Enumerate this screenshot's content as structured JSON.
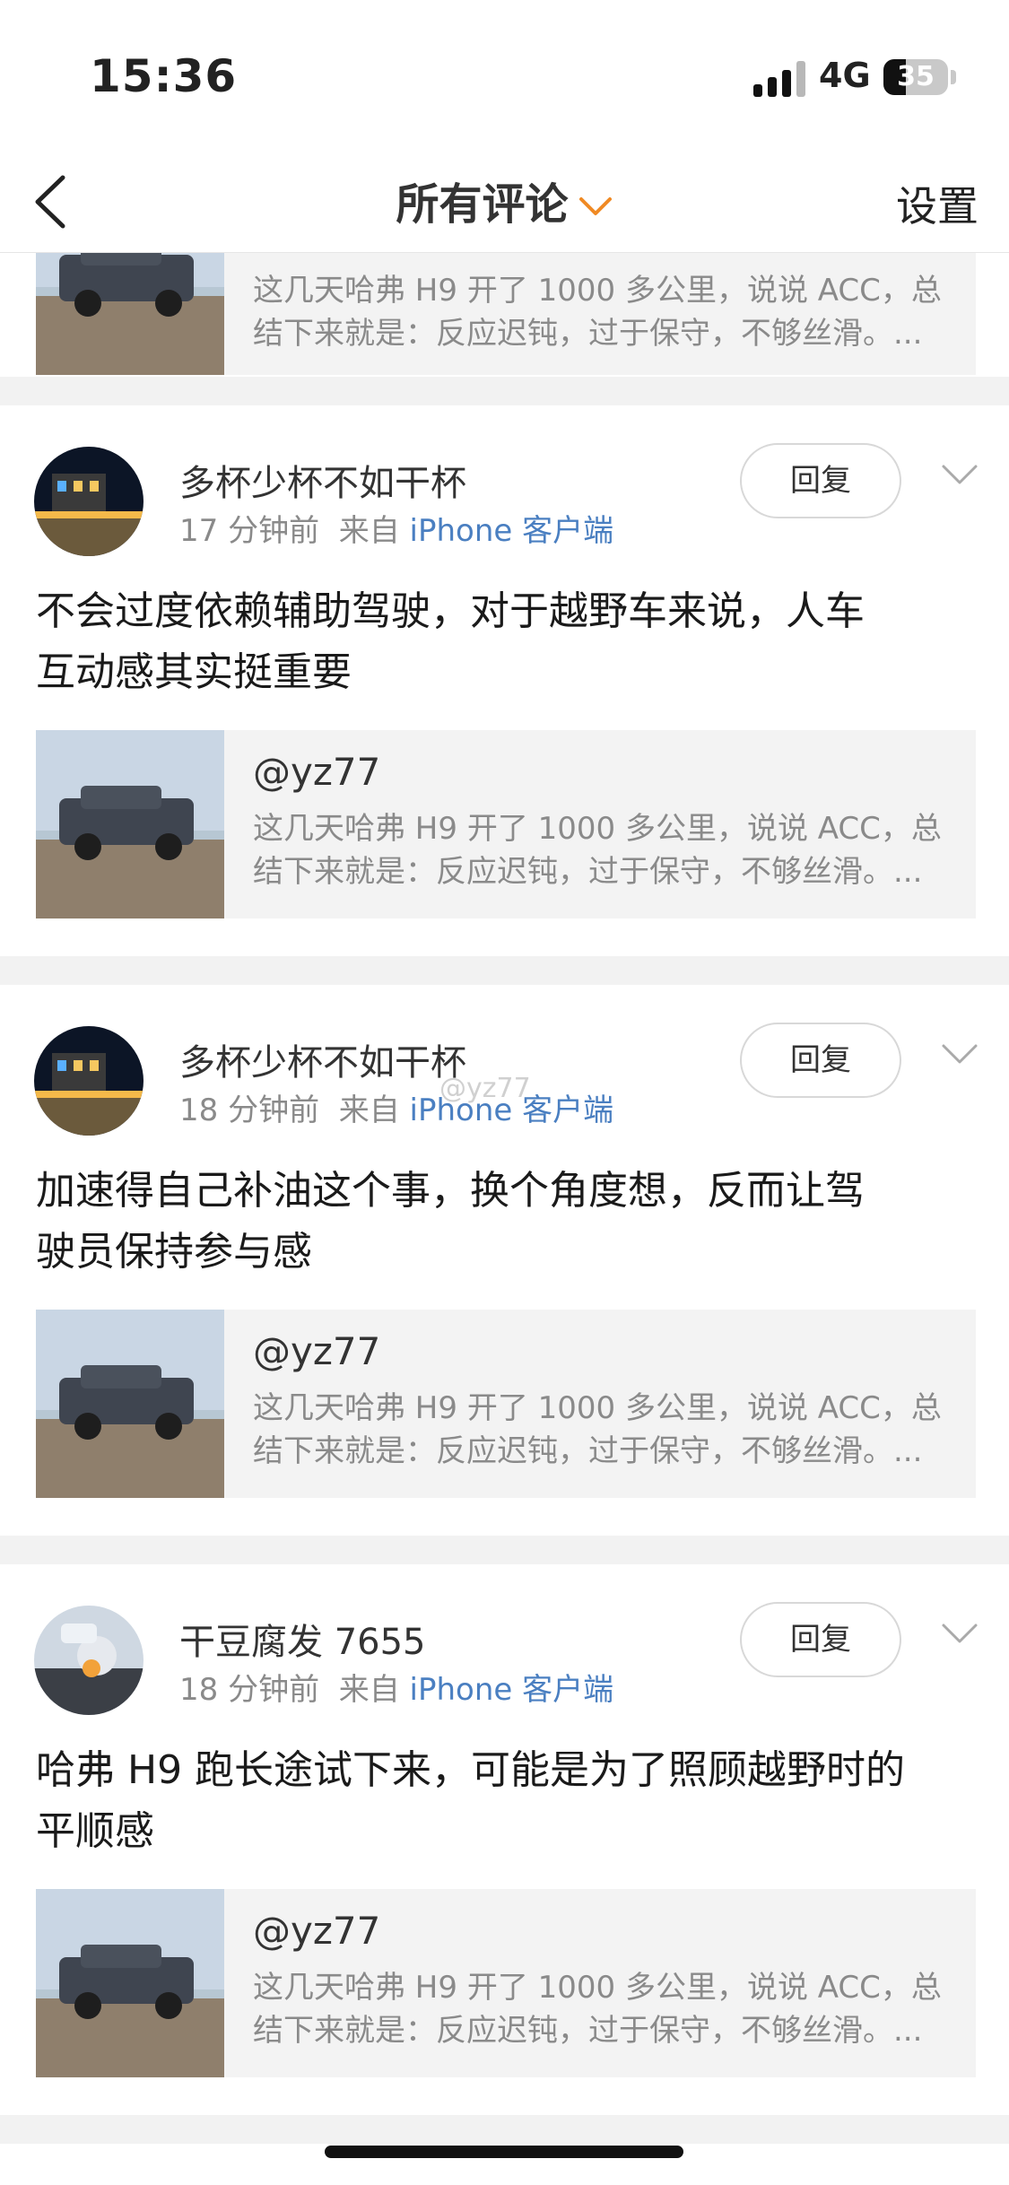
{
  "status": {
    "time": "15:36",
    "network": "4G",
    "battery": "35",
    "battery_level": 0.35
  },
  "nav": {
    "title": "所有评论",
    "settings": "设置"
  },
  "quoted_post": {
    "user": "@yz77",
    "line1": "这几天哈弗 H9 开了 1000 多公里，说说 ACC，总",
    "line2": "结下来就是：反应迟钝，过于保守，不够丝滑。..."
  },
  "reply_label": "回复",
  "source_prefix": "来自",
  "source_app": "iPhone 客户端",
  "comments": [
    {
      "user": "多杯少杯不如干杯",
      "time": "17 分钟前",
      "line1": "不会过度依赖辅助驾驶，对于越野车来说，人车",
      "line2": "互动感其实挺重要"
    },
    {
      "user": "多杯少杯不如干杯",
      "time": "18 分钟前",
      "line1": "加速得自己补油这个事，换个角度想，反而让驾",
      "line2": "驶员保持参与感"
    },
    {
      "user": "干豆腐发 7655",
      "time": "18 分钟前",
      "line1": "哈弗 H9 跑长途试下来，可能是为了照顾越野时的",
      "line2": "平顺感"
    }
  ],
  "watermark": "@yz77"
}
